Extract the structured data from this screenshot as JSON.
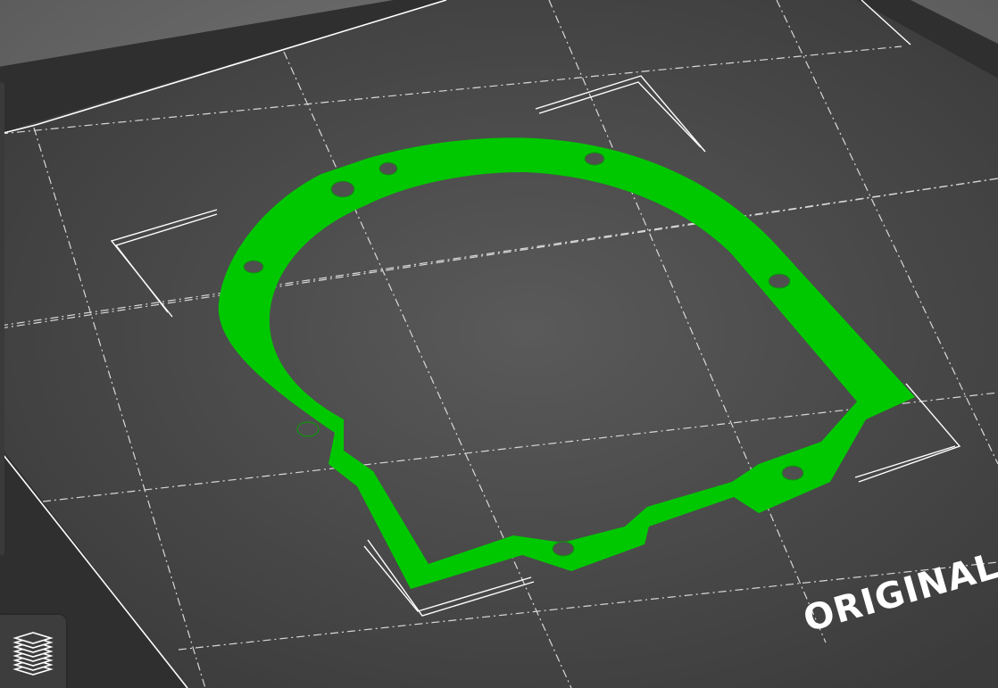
{
  "viewport": {
    "bed_label": "ORIGINAL",
    "colors": {
      "bed_surface": "#444444",
      "bed_frame": "#2d2d2d",
      "grid_lines": "#e6e6e6",
      "model_fill": "#00c800",
      "hole_fill": "#4f4f4f"
    },
    "model": {
      "name": "gasket-part",
      "mounting_holes": 8
    }
  },
  "toolbar": {
    "layers_button_icon": "layers-icon"
  }
}
